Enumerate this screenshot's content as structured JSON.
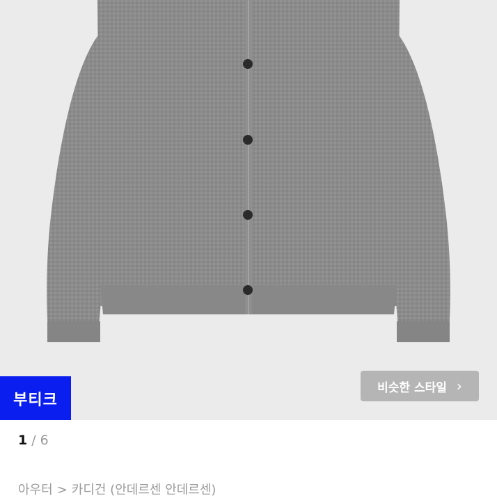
{
  "product_image": {
    "description_icon": "cardigan-photo",
    "background_color": "#ebebeb",
    "garment_color": "#8a8a8a"
  },
  "badge": {
    "label": "부티크",
    "color": "#0a1ef0"
  },
  "similar_style_button": {
    "label": "비슷한 스타일",
    "icon": "chevron-right-icon"
  },
  "pager": {
    "current": "1",
    "separator": "/",
    "total": "6"
  },
  "breadcrumb": {
    "items": [
      "아우터",
      "카디건 (안데르센 안데르센)"
    ],
    "separator": ">"
  }
}
